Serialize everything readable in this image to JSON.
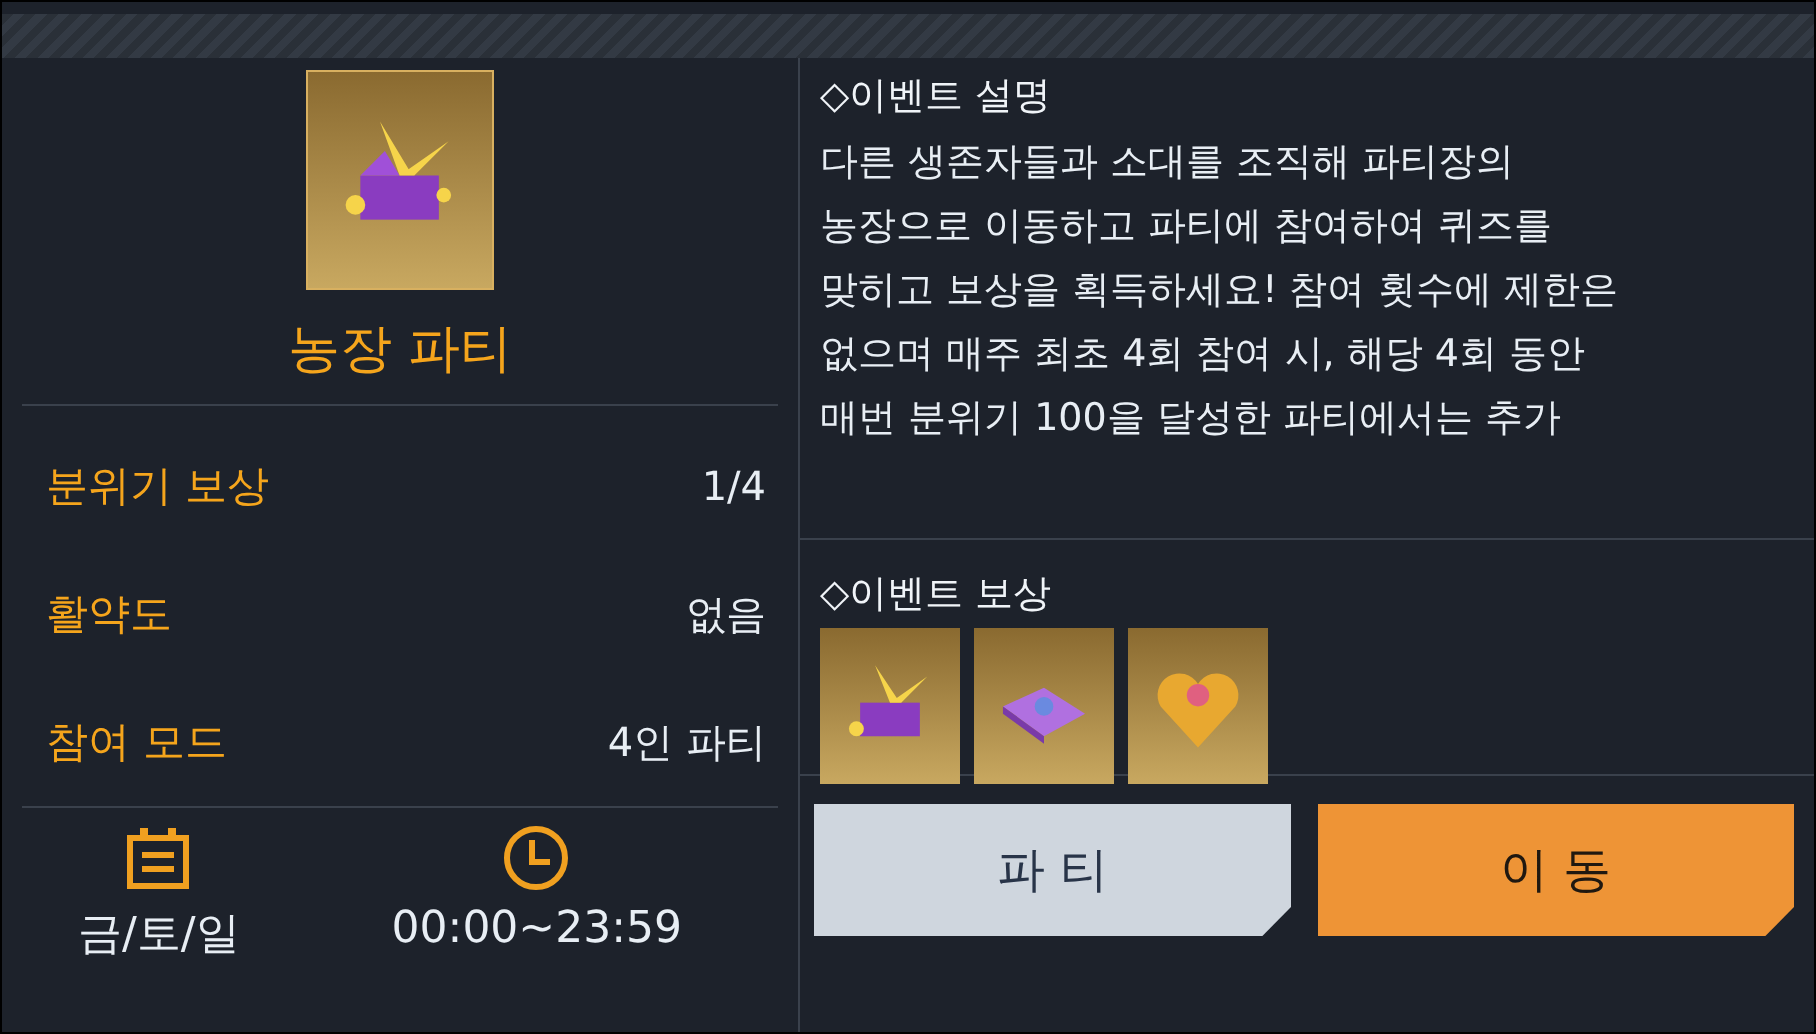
{
  "event": {
    "title": "농장 파티",
    "stats": [
      {
        "label": "분위기 보상",
        "value": "1/4"
      },
      {
        "label": "활약도",
        "value": "없음"
      },
      {
        "label": "참여 모드",
        "value": "4인 파티"
      }
    ],
    "days": "금/토/일",
    "hours": "00:00~23:59"
  },
  "description": {
    "heading": "◇이벤트 설명",
    "lines": [
      "다른 생존자들과 소대를 조직해 파티장의",
      "농장으로 이동하고 파티에 참여하여 퀴즈를",
      "맞히고 보상을 획득하세요! 참여 횟수에 제한은",
      "없으며 매주 최초 4회 참여 시, 해당 4회 동안",
      "매번 분위기 100을 달성한 파티에서는 추가"
    ]
  },
  "rewards": {
    "heading": "◇이벤트 보상",
    "items": [
      {
        "kind": "burst"
      },
      {
        "kind": "box"
      },
      {
        "kind": "heart"
      }
    ]
  },
  "buttons": [
    {
      "label": "파 티",
      "kind": "secondary"
    },
    {
      "label": "이 동",
      "kind": "primary"
    }
  ]
}
